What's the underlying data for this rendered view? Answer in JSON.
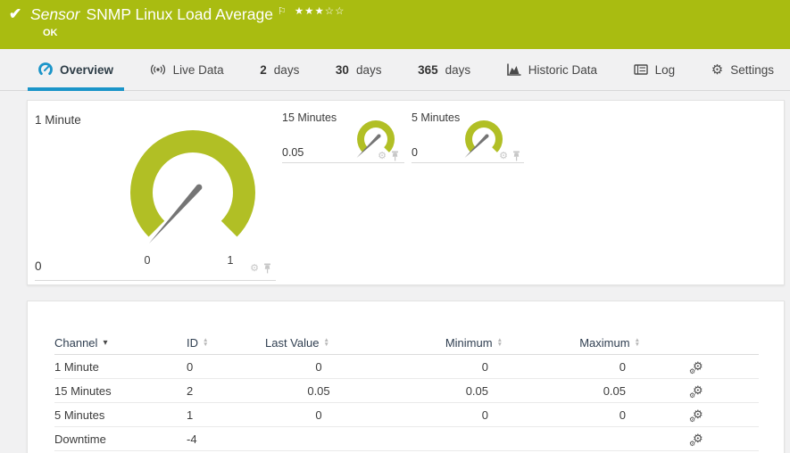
{
  "header": {
    "type_label": "Sensor",
    "title": "SNMP Linux Load Average",
    "status": "OK",
    "rating": "★★★☆☆"
  },
  "tabs": [
    {
      "label": "Overview",
      "active": true
    },
    {
      "label": "Live Data"
    },
    {
      "prefix": "2",
      "label": "days"
    },
    {
      "prefix": "30",
      "label": "days"
    },
    {
      "prefix": "365",
      "label": "days"
    },
    {
      "label": "Historic Data"
    },
    {
      "label": "Log"
    },
    {
      "label": "Settings"
    }
  ],
  "gauges": {
    "primary": {
      "label": "1 Minute",
      "value": "0",
      "scale_start": "0",
      "scale_end": "1"
    },
    "g15": {
      "label": "15 Minutes",
      "value": "0.05"
    },
    "g5": {
      "label": "5 Minutes",
      "value": "0"
    }
  },
  "channel_table": {
    "columns": [
      "Channel",
      "ID",
      "Last Value",
      "Minimum",
      "Maximum"
    ],
    "rows": [
      {
        "channel": "1 Minute",
        "id": "0",
        "last": "0",
        "min": "0",
        "max": "0"
      },
      {
        "channel": "15 Minutes",
        "id": "2",
        "last": "0.05",
        "min": "0.05",
        "max": "0.05"
      },
      {
        "channel": "5 Minutes",
        "id": "1",
        "last": "0",
        "min": "0",
        "max": "0"
      },
      {
        "channel": "Downtime",
        "id": "-4",
        "last": "",
        "min": "",
        "max": ""
      }
    ]
  },
  "icons": {
    "check": "✔",
    "flag": "⚐",
    "gear": "⚙",
    "sort_up": "▲",
    "sort_down": "▼",
    "sorted_desc": "▾"
  },
  "colors": {
    "status_green": "#a9bc11",
    "gauge_green": "#b1bf25",
    "accent_blue": "#1b95c9",
    "needle_gray": "#757575"
  }
}
